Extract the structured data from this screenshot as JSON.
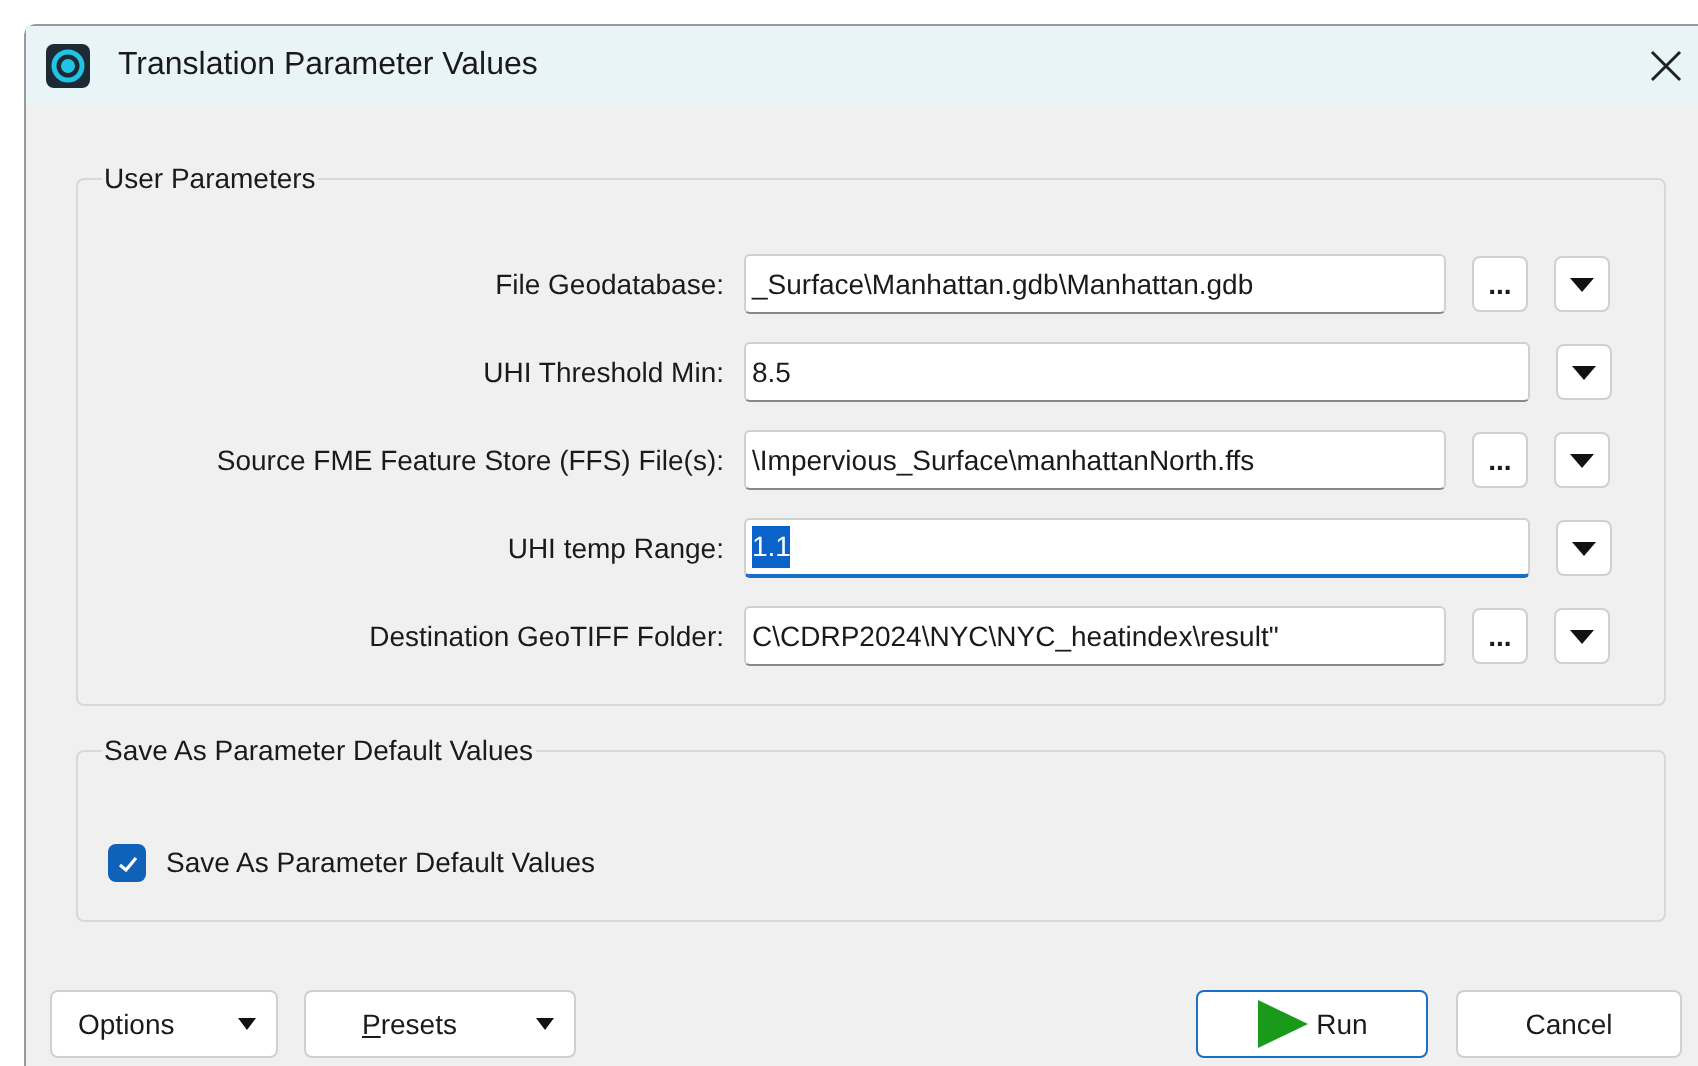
{
  "window": {
    "title": "Translation Parameter Values"
  },
  "user_parameters": {
    "title": "User Parameters",
    "rows": [
      {
        "label": "File Geodatabase:",
        "value": "_Surface\\Manhattan.gdb\\Manhattan.gdb",
        "browse": "...",
        "focused": false
      },
      {
        "label": "UHI Threshold Min:",
        "value": "8.5",
        "focused": false
      },
      {
        "label": "Source FME Feature Store (FFS) File(s):",
        "value": "\\Impervious_Surface\\manhattanNorth.ffs",
        "browse": "...",
        "focused": false
      },
      {
        "label": "UHI temp Range:",
        "value": "1.1",
        "focused": true
      },
      {
        "label": "Destination GeoTIFF Folder:",
        "value": "C\\CDRP2024\\NYC\\NYC_heatindex\\result\"",
        "browse": "...",
        "focused": false
      }
    ]
  },
  "save_defaults": {
    "title": "Save As Parameter Default Values",
    "checkbox": {
      "label": "Save As Parameter Default Values",
      "checked": true
    }
  },
  "left_buttons": [
    {
      "label": "Options",
      "underline_first": false
    },
    {
      "label": "Presets",
      "underline_first": true
    }
  ],
  "right_buttons": [
    {
      "kind": "run",
      "label": "Run"
    },
    {
      "kind": "cancel",
      "label": "Cancel"
    }
  ]
}
